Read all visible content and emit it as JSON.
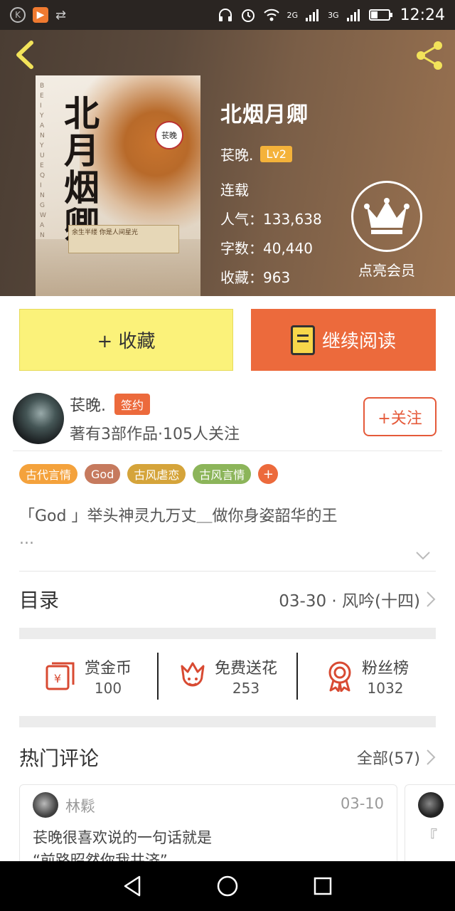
{
  "status_bar": {
    "time": "12:24",
    "net1": "2G",
    "net2": "3G",
    "left_icons": [
      "k-icon",
      "play-app-icon",
      "link-icon"
    ],
    "right_icons": [
      "headset-icon",
      "alarm-icon",
      "wifi-icon",
      "signal-icon",
      "signal-icon",
      "battery-icon"
    ]
  },
  "book": {
    "title": "北烟月卿",
    "author": "苌晚.",
    "level": "Lv2",
    "status": "连载",
    "popularity": "人气：133,638",
    "word_count": "字数：40,440",
    "favorites": "收藏：963",
    "cover_title_art": "北月烟卿",
    "cover_stamp": "苌晚",
    "cover_vertical": "BEIYANYUEQINGWAN",
    "cover_banner": "余生半缕 你是人间星光"
  },
  "vip": {
    "label": "点亮会员"
  },
  "actions": {
    "collect": "+ 收藏",
    "continue": "继续阅读"
  },
  "author_card": {
    "name": "苌晚.",
    "badge": "签约",
    "meta": "著有3部作品·105人关注",
    "follow": "+关注"
  },
  "tags": [
    {
      "label": "古代言情",
      "color": "#f4a23c"
    },
    {
      "label": "God",
      "color": "#c67a5e"
    },
    {
      "label": "古风虐恋",
      "color": "#d5a43a"
    },
    {
      "label": "古风言情",
      "color": "#8cb55a"
    }
  ],
  "tag_add": "+",
  "description": {
    "text": "「God 」举头神灵九万丈＿做你身姿韶华的王",
    "ellipsis": "..."
  },
  "toc": {
    "label": "目录",
    "latest": "03-30 · 风吟(十四)"
  },
  "stats": [
    {
      "label": "赏金币",
      "value": "100",
      "icon": "red-envelope-icon"
    },
    {
      "label": "免费送花",
      "value": "253",
      "icon": "flower-icon"
    },
    {
      "label": "粉丝榜",
      "value": "1032",
      "icon": "medal-icon"
    }
  ],
  "comments": {
    "label": "热门评论",
    "all": "全部(57)",
    "items": [
      {
        "user": "林鬏",
        "date": "03-10",
        "line1": "苌晚很喜欢说的一句话就是",
        "line2": "“前路昭然你我共济”"
      }
    ],
    "peek": "『"
  },
  "colors": {
    "accent": "#ec6a3c",
    "collect_bg": "#fbf27a",
    "level_badge": "#f4b23a"
  }
}
